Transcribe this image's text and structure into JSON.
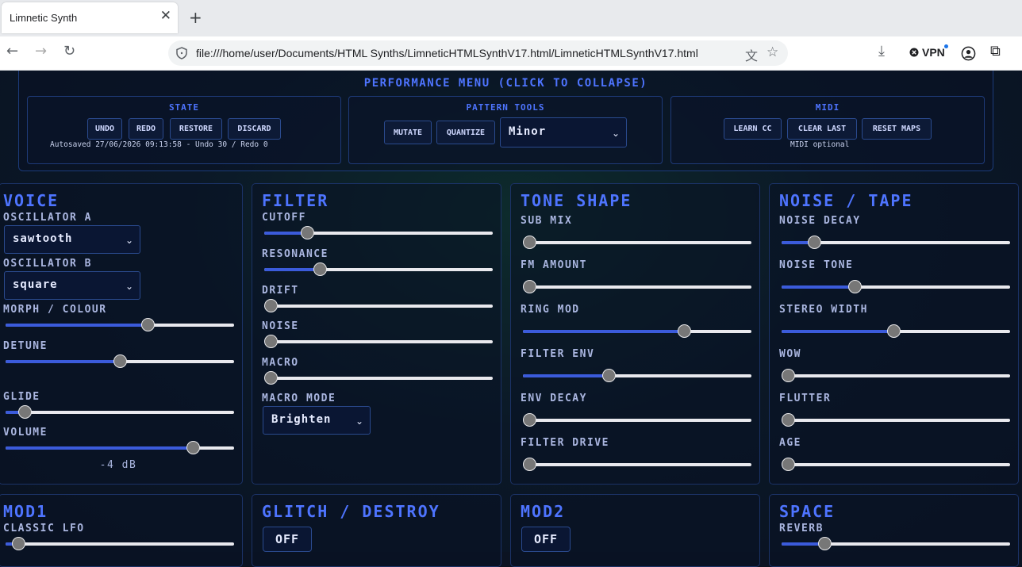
{
  "browser": {
    "tab_title": "Limnetic Synth",
    "url": "file:///home/user/Documents/HTML Synths/LimneticHTMLSynthV17.html/LimneticHTMLSynthV17.html",
    "vpn_label": "VPN"
  },
  "perf_menu": {
    "title": "PERFORMANCE MENU (CLICK TO COLLAPSE)",
    "state": {
      "title": "STATE",
      "buttons": [
        "UNDO",
        "REDO",
        "RESTORE",
        "DISCARD"
      ],
      "status": "Autosaved 27/06/2026 09:13:58 - Undo 30 / Redo 0"
    },
    "pattern_tools": {
      "title": "PATTERN TOOLS",
      "buttons": [
        "MUTATE",
        "QUANTIZE"
      ],
      "scale_value": "Minor"
    },
    "midi": {
      "title": "MIDI",
      "buttons": [
        "LEARN CC",
        "CLEAR LAST",
        "RESET MAPS"
      ],
      "note": "MIDI optional"
    }
  },
  "voice": {
    "title": "VOICE",
    "osc_a_label": "OSCILLATOR A",
    "osc_a_value": "sawtooth",
    "osc_b_label": "OSCILLATOR B",
    "osc_b_value": "square",
    "sliders": [
      {
        "label": "MORPH / COLOUR",
        "value": 0.63
      },
      {
        "label": "DETUNE",
        "value": 0.5
      },
      {
        "label": "GLIDE",
        "value": 0.06
      },
      {
        "label": "VOLUME",
        "value": 0.84
      }
    ],
    "volume_readout": "-4 dB"
  },
  "filter": {
    "title": "FILTER",
    "sliders": [
      {
        "label": "CUTOFF",
        "value": 0.17
      },
      {
        "label": "RESONANCE",
        "value": 0.23
      },
      {
        "label": "DRIFT",
        "value": 0.0
      },
      {
        "label": "NOISE",
        "value": 0.0
      },
      {
        "label": "MACRO",
        "value": 0.0
      }
    ],
    "macro_mode_label": "MACRO MODE",
    "macro_mode_value": "Brighten"
  },
  "tone_shape": {
    "title": "TONE SHAPE",
    "sliders": [
      {
        "label": "SUB MIX",
        "value": 0.0
      },
      {
        "label": "FM AMOUNT",
        "value": 0.0
      },
      {
        "label": "RING MOD",
        "value": 0.72
      },
      {
        "label": "FILTER ENV",
        "value": 0.37
      },
      {
        "label": "ENV DECAY",
        "value": 0.0
      },
      {
        "label": "FILTER DRIVE",
        "value": 0.0
      }
    ]
  },
  "noise_tape": {
    "title": "NOISE / TAPE",
    "sliders": [
      {
        "label": "NOISE DECAY",
        "value": 0.12
      },
      {
        "label": "NOISE TONE",
        "value": 0.31
      },
      {
        "label": "STEREO WIDTH",
        "value": 0.49
      },
      {
        "label": "WOW",
        "value": 0.0
      },
      {
        "label": "FLUTTER",
        "value": 0.0
      },
      {
        "label": "AGE",
        "value": 0.0
      }
    ]
  },
  "mod1": {
    "title": "MOD1",
    "sliders": [
      {
        "label": "CLASSIC LFO",
        "value": 0.03
      }
    ]
  },
  "glitch": {
    "title": "GLITCH / DESTROY",
    "toggle": "OFF"
  },
  "mod2": {
    "title": "MOD2",
    "toggle": "OFF"
  },
  "space": {
    "title": "SPACE",
    "sliders": [
      {
        "label": "REVERB",
        "value": 0.17
      }
    ]
  },
  "colors": {
    "accent": "#4e74ff",
    "fill": "#3b5bdb",
    "background": "#0b1322"
  }
}
